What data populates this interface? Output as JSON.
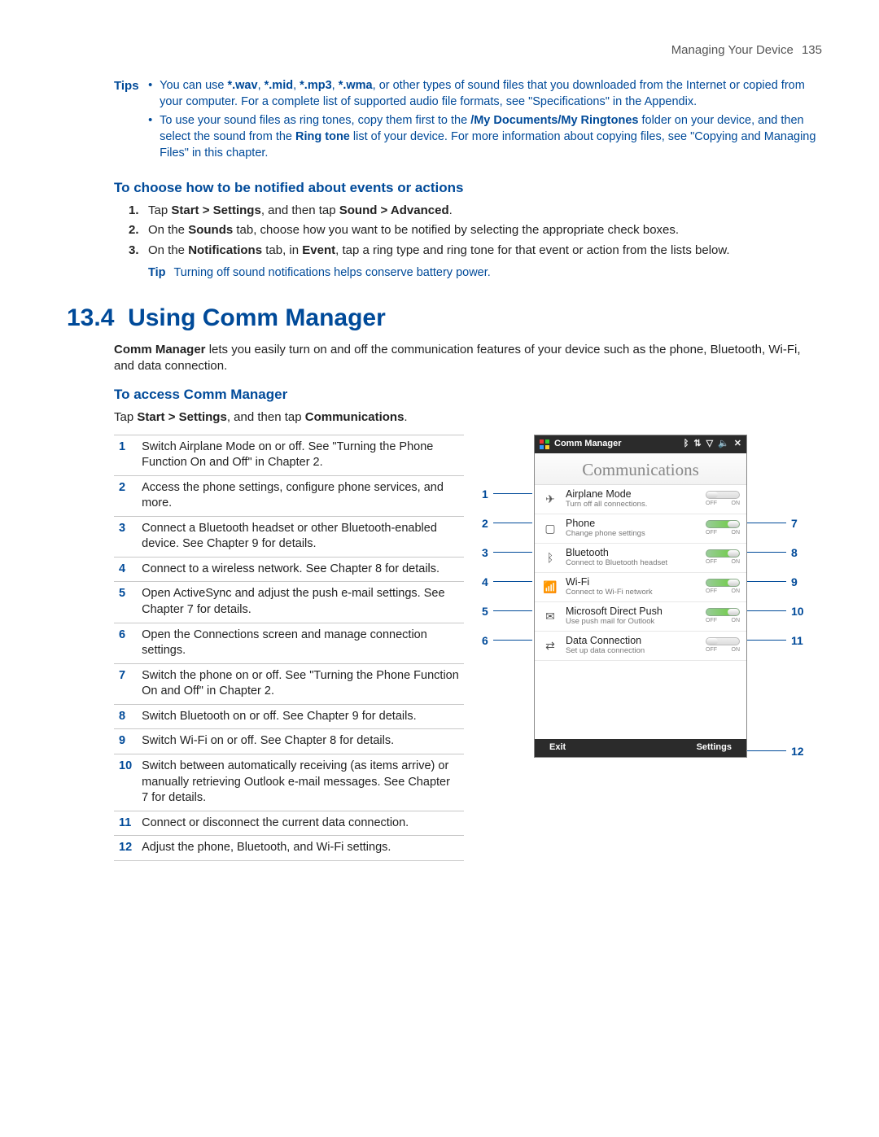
{
  "header": {
    "title": "Managing Your Device",
    "page_number": "135"
  },
  "tips": {
    "label": "Tips",
    "items": [
      {
        "pre": "You can use ",
        "bold1": "*.wav",
        "c1": ", ",
        "bold2": "*.mid",
        "c2": ", ",
        "bold3": "*.mp3",
        "c3": ", ",
        "bold4": "*.wma",
        "post": ", or other types of sound files that you downloaded from the Internet or copied from your computer. For a complete list of supported audio file formats, see \"Specifications\" in the Appendix."
      },
      {
        "pre": "To use your sound files as ring tones, copy them first to the ",
        "bold1": "/My Documents/My Ringtones",
        "mid": " folder on your device, and then select the sound from the ",
        "bold2": "Ring tone",
        "post": " list of your device. For more information about copying files, see \"Copying and Managing Files\" in this chapter."
      }
    ]
  },
  "notify": {
    "heading": "To choose how to be notified about events or actions",
    "steps": [
      {
        "n": "1.",
        "pre": "Tap ",
        "b1": "Start > Settings",
        "mid": ", and then tap ",
        "b2": "Sound > Advanced",
        "post": "."
      },
      {
        "n": "2.",
        "pre": "On the ",
        "b1": "Sounds",
        "post": " tab, choose how you want to be notified by selecting the appropriate check boxes."
      },
      {
        "n": "3.",
        "pre": "On the ",
        "b1": "Notifications",
        "mid": " tab, in ",
        "b2": "Event",
        "post": ", tap a ring type and ring tone for that event or action from the lists below."
      }
    ],
    "tip_label": "Tip",
    "tip_text": "Turning off sound notifications helps conserve battery power."
  },
  "section": {
    "number": "13.4",
    "title": "Using Comm Manager",
    "intro_b": "Comm Manager",
    "intro_rest": " lets you easily turn on and off the communication features of your device such as the phone, Bluetooth, Wi-Fi, and data connection."
  },
  "access": {
    "heading": "To access Comm Manager",
    "line_pre": "Tap ",
    "line_b1": "Start > Settings",
    "line_mid": ", and then tap ",
    "line_b2": "Communications",
    "line_post": "."
  },
  "desc_rows": [
    {
      "n": "1",
      "t": "Switch Airplane Mode on or off. See \"Turning the Phone Function On and Off\" in Chapter 2."
    },
    {
      "n": "2",
      "t": "Access the phone settings, configure phone services, and more."
    },
    {
      "n": "3",
      "t": "Connect a Bluetooth headset or other Bluetooth-enabled device. See Chapter 9 for details."
    },
    {
      "n": "4",
      "t": "Connect to a wireless network. See Chapter 8 for details."
    },
    {
      "n": "5",
      "t": "Open ActiveSync and adjust the push e-mail settings. See Chapter 7 for details."
    },
    {
      "n": "6",
      "t": "Open the Connections screen and manage connection settings."
    },
    {
      "n": "7",
      "t": "Switch the phone on or off. See \"Turning the Phone Function On and Off\" in Chapter 2."
    },
    {
      "n": "8",
      "t": "Switch Bluetooth on or off. See Chapter 9 for details."
    },
    {
      "n": "9",
      "t": "Switch Wi-Fi on or off. See Chapter 8 for details."
    },
    {
      "n": "10",
      "t": "Switch between automatically receiving (as items arrive) or manually retrieving Outlook e-mail messages. See Chapter 7 for details."
    },
    {
      "n": "11",
      "t": "Connect or disconnect the current data connection."
    },
    {
      "n": "12",
      "t": "Adjust the phone, Bluetooth, and Wi-Fi settings."
    }
  ],
  "shot": {
    "titlebar": "Comm Manager",
    "heading": "Communications",
    "items": [
      {
        "icon": "✈",
        "title": "Airplane Mode",
        "sub": "Turn off all connections.",
        "state": "off"
      },
      {
        "icon": "▢",
        "title": "Phone",
        "sub": "Change phone settings",
        "state": "on"
      },
      {
        "icon": "ᛒ",
        "title": "Bluetooth",
        "sub": "Connect to Bluetooth headset",
        "state": "on"
      },
      {
        "icon": "📶",
        "title": "Wi-Fi",
        "sub": "Connect to Wi-Fi network",
        "state": "on"
      },
      {
        "icon": "✉",
        "title": "Microsoft Direct Push",
        "sub": "Use push mail for Outlook",
        "state": "on"
      },
      {
        "icon": "⇄",
        "title": "Data Connection",
        "sub": "Set up data connection",
        "state": "off"
      }
    ],
    "toggle_off": "OFF",
    "toggle_on": "ON",
    "footer_left": "Exit",
    "footer_right": "Settings"
  },
  "callouts_left": [
    "1",
    "2",
    "3",
    "4",
    "5",
    "6"
  ],
  "callouts_right": [
    "7",
    "8",
    "9",
    "10",
    "11",
    "12"
  ]
}
